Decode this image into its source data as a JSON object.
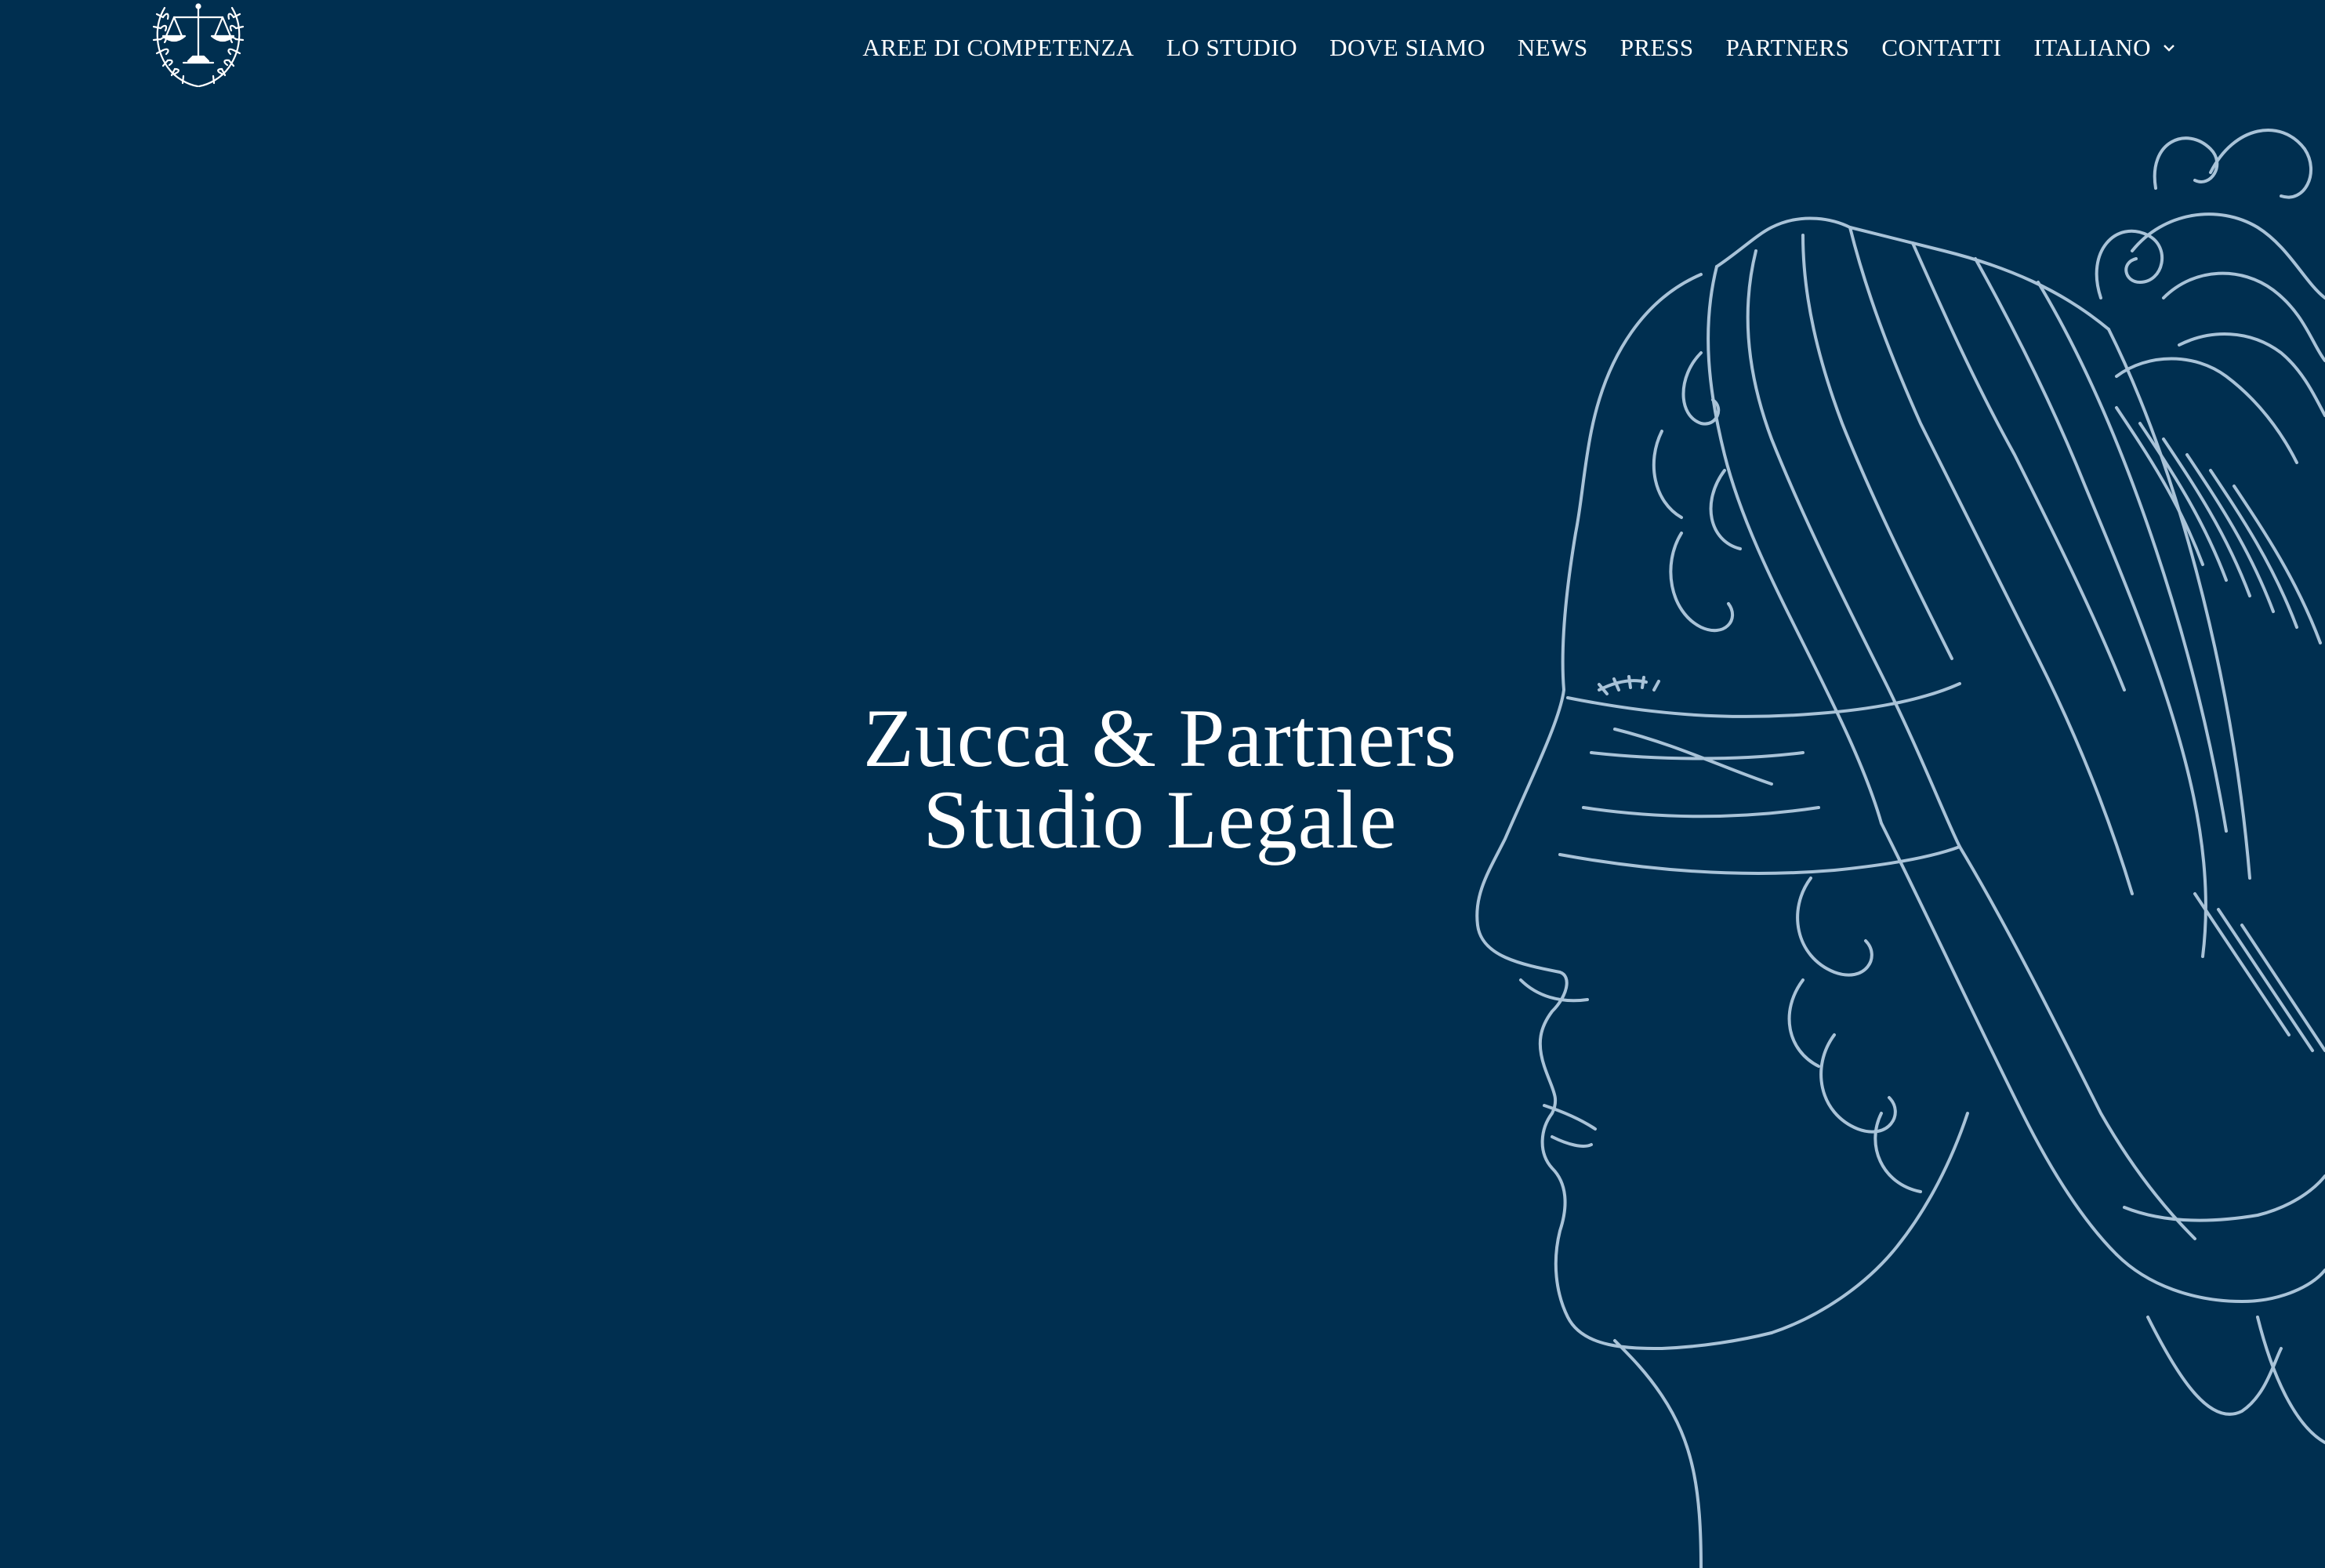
{
  "header": {
    "logo_icon": "scales-of-justice-laurel-icon",
    "nav": [
      {
        "label": "AREE DI COMPETENZA"
      },
      {
        "label": "LO STUDIO"
      },
      {
        "label": "DOVE SIAMO"
      },
      {
        "label": "NEWS"
      },
      {
        "label": "PRESS"
      },
      {
        "label": "PARTNERS"
      },
      {
        "label": "CONTATTI"
      }
    ],
    "language": {
      "label": "ITALIANO",
      "icon": "chevron-down-icon"
    }
  },
  "hero": {
    "title_line1": "Zucca & Partners",
    "title_line2": "Studio Legale",
    "illustration": "blindfolded-lady-justice-line-art"
  },
  "colors": {
    "background": "#002f50",
    "text": "#ffffff",
    "line_art": "#a9c3d8"
  }
}
